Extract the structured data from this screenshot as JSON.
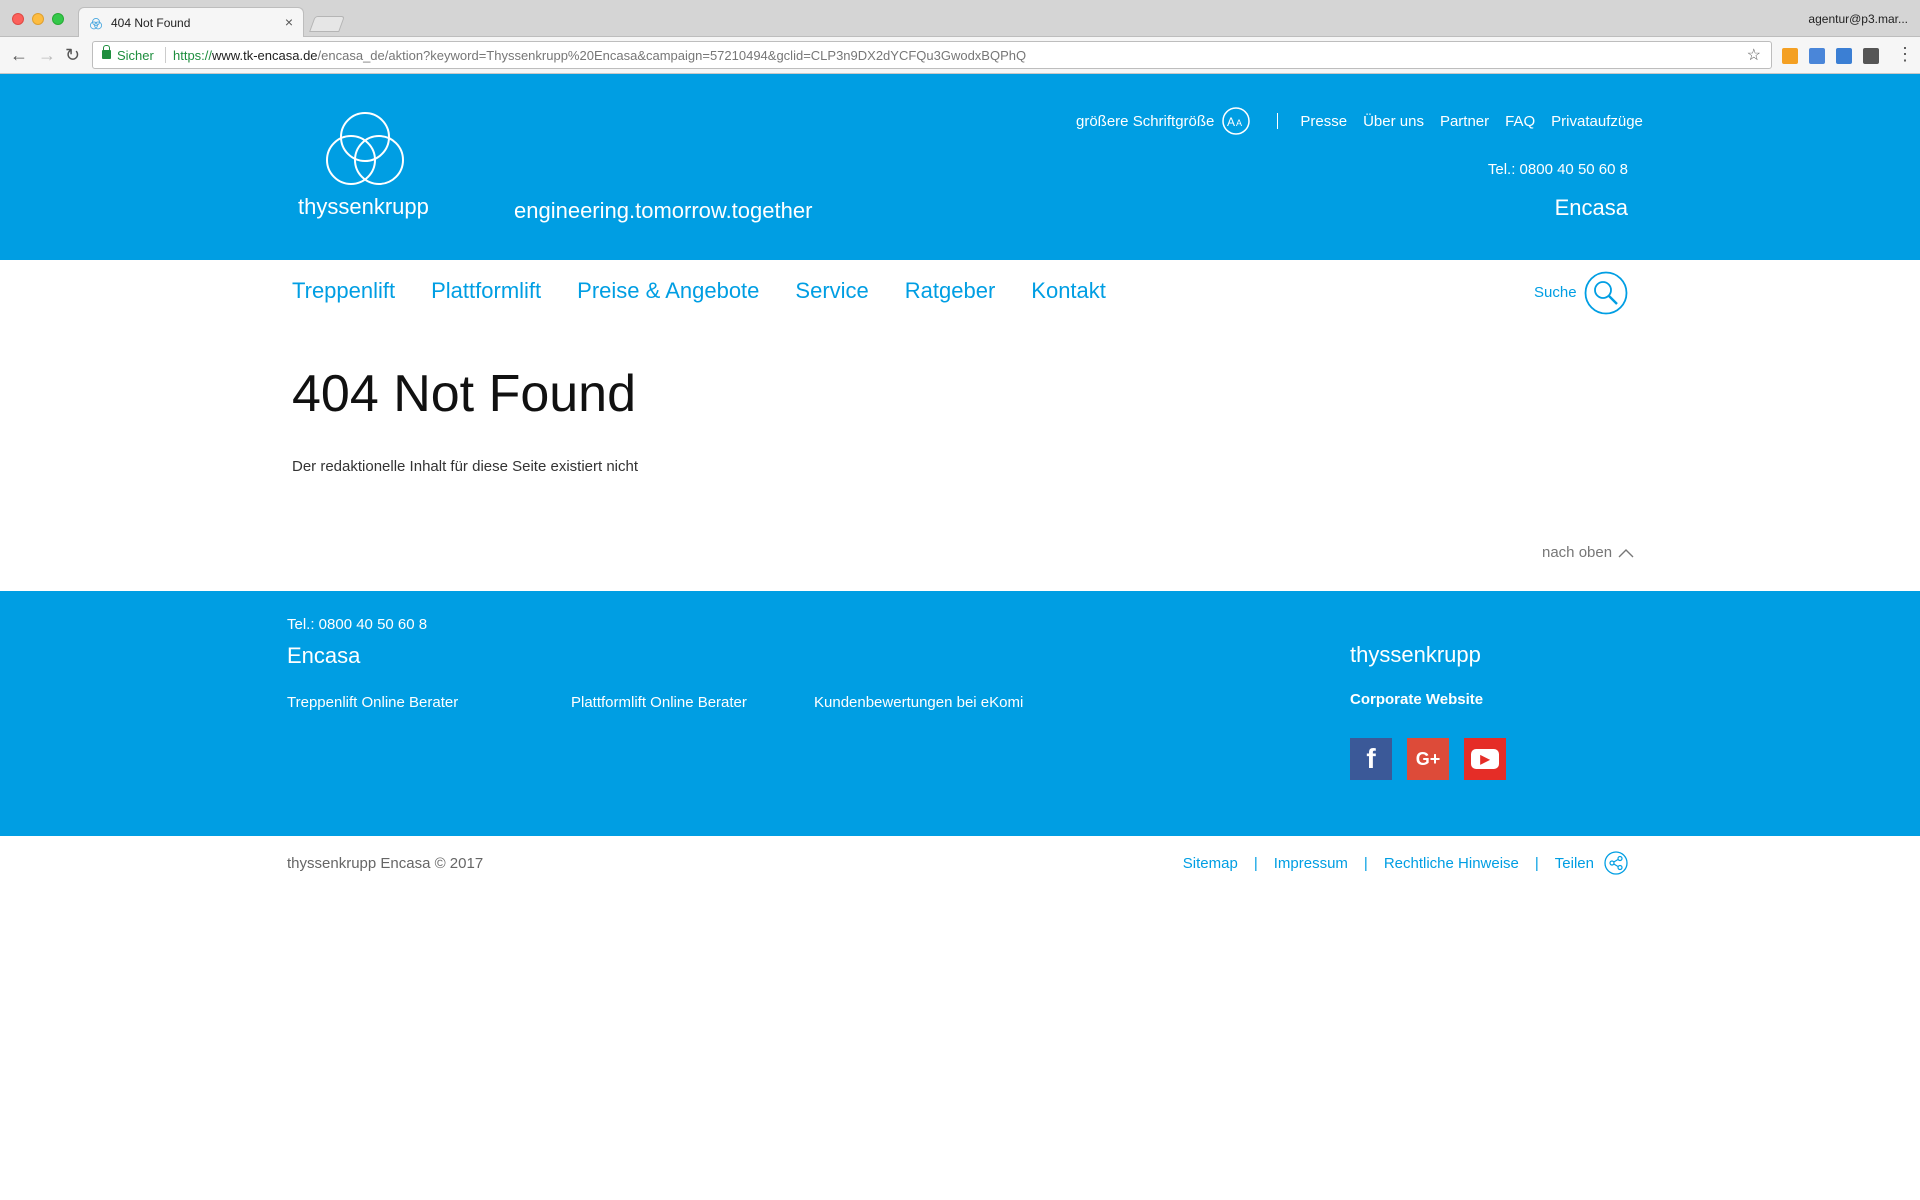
{
  "browser": {
    "tab_title": "404 Not Found",
    "tab_close": "×",
    "profile": "agentur@p3.mar...",
    "secure_label": "Sicher",
    "url_scheme": "https://",
    "url_host": "www.tk-encasa.de",
    "url_path": "/encasa_de/aktion?keyword=Thyssenkrupp%20Encasa&campaign=57210494&gclid=CLP3n9DX2dYCFQu3GwodxBQPhQ",
    "back": "←",
    "forward": "→",
    "reload": "↻",
    "bookmark": "☆",
    "menu": "⋮",
    "extension_colors": [
      "#f4a023",
      "#4a86d9",
      "#3b7fd4",
      "#555555"
    ]
  },
  "header": {
    "brand": "thyssenkrupp",
    "tagline": "engineering.tomorrow.together",
    "font_size_label": "größere Schriftgröße",
    "top_menu": [
      "Presse",
      "Über uns",
      "Partner",
      "FAQ",
      "Privataufzüge"
    ],
    "phone": "Tel.: 0800 40 50 60 8",
    "product": "Encasa"
  },
  "nav": {
    "items": [
      "Treppenlift",
      "Plattformlift",
      "Preise & Angebote",
      "Service",
      "Ratgeber",
      "Kontakt"
    ],
    "search_label": "Suche"
  },
  "content": {
    "title": "404 Not Found",
    "text": "Der redaktionelle Inhalt für diese Seite existiert nicht",
    "to_top": "nach oben"
  },
  "footer": {
    "phone": "Tel.: 0800 40 50 60 8",
    "product": "Encasa",
    "links": [
      "Treppenlift Online Berater",
      "Plattformlift Online Berater",
      "Kundenbewertungen bei eKomi"
    ],
    "brand": "thyssenkrupp",
    "corporate": "Corporate Website",
    "social": {
      "facebook": "f",
      "googleplus": "G+",
      "youtube": "▶"
    }
  },
  "bottom": {
    "copyright": "thyssenkrupp Encasa © 2017",
    "links": [
      "Sitemap",
      "Impressum",
      "Rechtliche Hinweise",
      "Teilen"
    ],
    "separator": "|"
  },
  "colors": {
    "brand_blue": "#009ee3",
    "chrome_bg": "#d5d5d5",
    "secure_green": "#1e8e3e"
  }
}
